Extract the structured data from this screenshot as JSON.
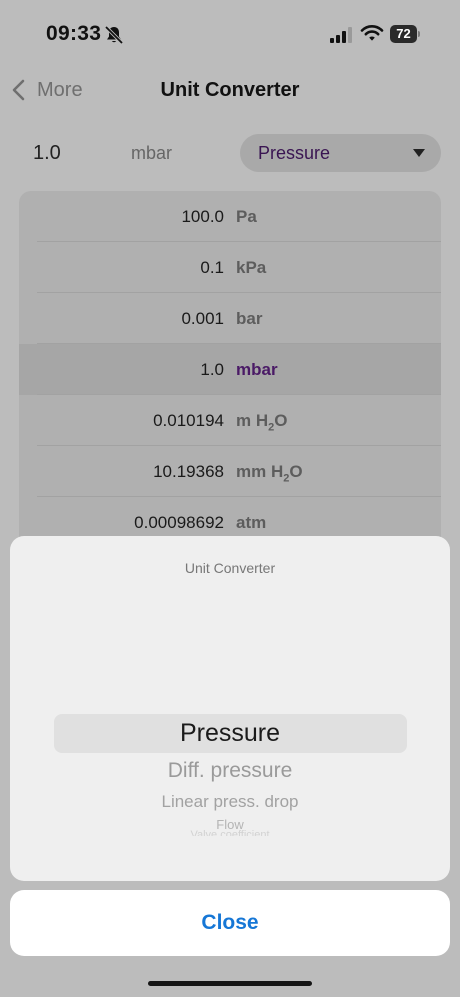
{
  "status_bar": {
    "time": "09:33",
    "battery": "72"
  },
  "nav": {
    "back_label": "More",
    "title": "Unit Converter"
  },
  "input": {
    "value": "1.0",
    "unit": "mbar",
    "category": "Pressure"
  },
  "results": [
    {
      "value": "100.0",
      "unit": "Pa",
      "selected": false
    },
    {
      "value": "0.1",
      "unit": "kPa",
      "selected": false
    },
    {
      "value": "0.001",
      "unit": "bar",
      "selected": false
    },
    {
      "value": "1.0",
      "unit": "mbar",
      "selected": true
    },
    {
      "value": "0.010194",
      "unit_main": "m H",
      "unit_sub": "2",
      "unit_tail": "O",
      "selected": false
    },
    {
      "value": "10.19368",
      "unit_main": "mm H",
      "unit_sub": "2",
      "unit_tail": "O",
      "selected": false
    },
    {
      "value": "0.00098692",
      "unit": "atm",
      "selected": false
    }
  ],
  "picker": {
    "title": "Unit Converter",
    "options": [
      "Pressure",
      "Diff. pressure",
      "Linear press. drop",
      "Flow",
      "Valve coefficient"
    ],
    "selected_index": 0
  },
  "close_label": "Close",
  "colors": {
    "accent": "#1677d6",
    "selected_unit": "#4a1a66",
    "category_text": "#3a1552"
  },
  "icons": [
    "bell-slash-icon",
    "cellular-signal-icon",
    "wifi-icon",
    "battery-icon",
    "chevron-left-icon",
    "caret-down-icon"
  ]
}
